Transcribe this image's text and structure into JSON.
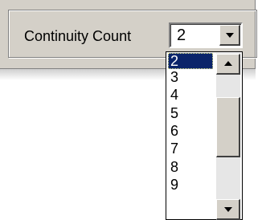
{
  "field": {
    "label": "Continuity Count",
    "value": "2"
  },
  "dropdown": {
    "options": [
      "2",
      "3",
      "4",
      "5",
      "6",
      "7",
      "8",
      "9"
    ],
    "selected_index": 0
  },
  "icons": {
    "combo_button": "chevron-down-icon",
    "scroll_up": "scroll-up-arrow-icon",
    "scroll_down": "scroll-down-arrow-icon"
  },
  "colors": {
    "selection": "#0a246a",
    "face": "#d4d0c8"
  }
}
